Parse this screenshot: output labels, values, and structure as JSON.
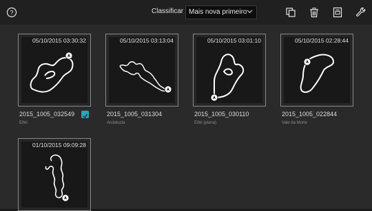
{
  "toolbar": {
    "help_icon": "help-circle-icon",
    "sort_label": "Classificar",
    "sort_value": "Mais nova primeiro",
    "actions": [
      "copy-icon",
      "trash-icon",
      "notebook-icon",
      "wrench-icon"
    ]
  },
  "tracks": [
    {
      "timestamp": "05/10/2015 03:30:32",
      "name": "2015_1005_032549",
      "location": "Eifel",
      "shared": true
    },
    {
      "timestamp": "05/10/2015 03:13:04",
      "name": "2015_1005_031304",
      "location": "Andaluzia",
      "shared": false
    },
    {
      "timestamp": "05/10/2015 03:01:10",
      "name": "2015_1005_030110",
      "location": "Eifel (plana)",
      "shared": false
    },
    {
      "timestamp": "05/10/2015 02:28:44",
      "name": "2015_1005_022844",
      "location": "Vale da Morte",
      "shared": false
    },
    {
      "timestamp": "01/10/2015 09:09:28",
      "name": "",
      "location": "",
      "shared": false
    }
  ],
  "colors": {
    "accent": "#2aa6b7",
    "background": "#2a2a2a",
    "topbar": "#202020"
  }
}
